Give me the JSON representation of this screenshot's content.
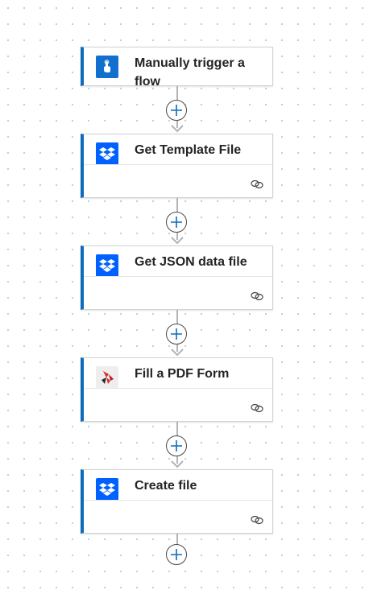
{
  "colors": {
    "accent": "#0f6cbd",
    "dropbox_blue": "#0061fe",
    "trigger_blue": "#1170cf"
  },
  "flow": {
    "steps": [
      {
        "title": "Manually trigger a flow",
        "icon": "hand-tap-icon",
        "has_link": false
      },
      {
        "title": "Get Template File",
        "icon": "dropbox-icon",
        "has_link": true
      },
      {
        "title": "Get JSON data file",
        "icon": "dropbox-icon",
        "has_link": true
      },
      {
        "title": "Fill a PDF Form",
        "icon": "pdf-form-icon",
        "has_link": true
      },
      {
        "title": "Create file",
        "icon": "dropbox-icon",
        "has_link": true
      }
    ],
    "insert_step_icon": "plus-icon",
    "link_icon": "chain-link-icon"
  }
}
